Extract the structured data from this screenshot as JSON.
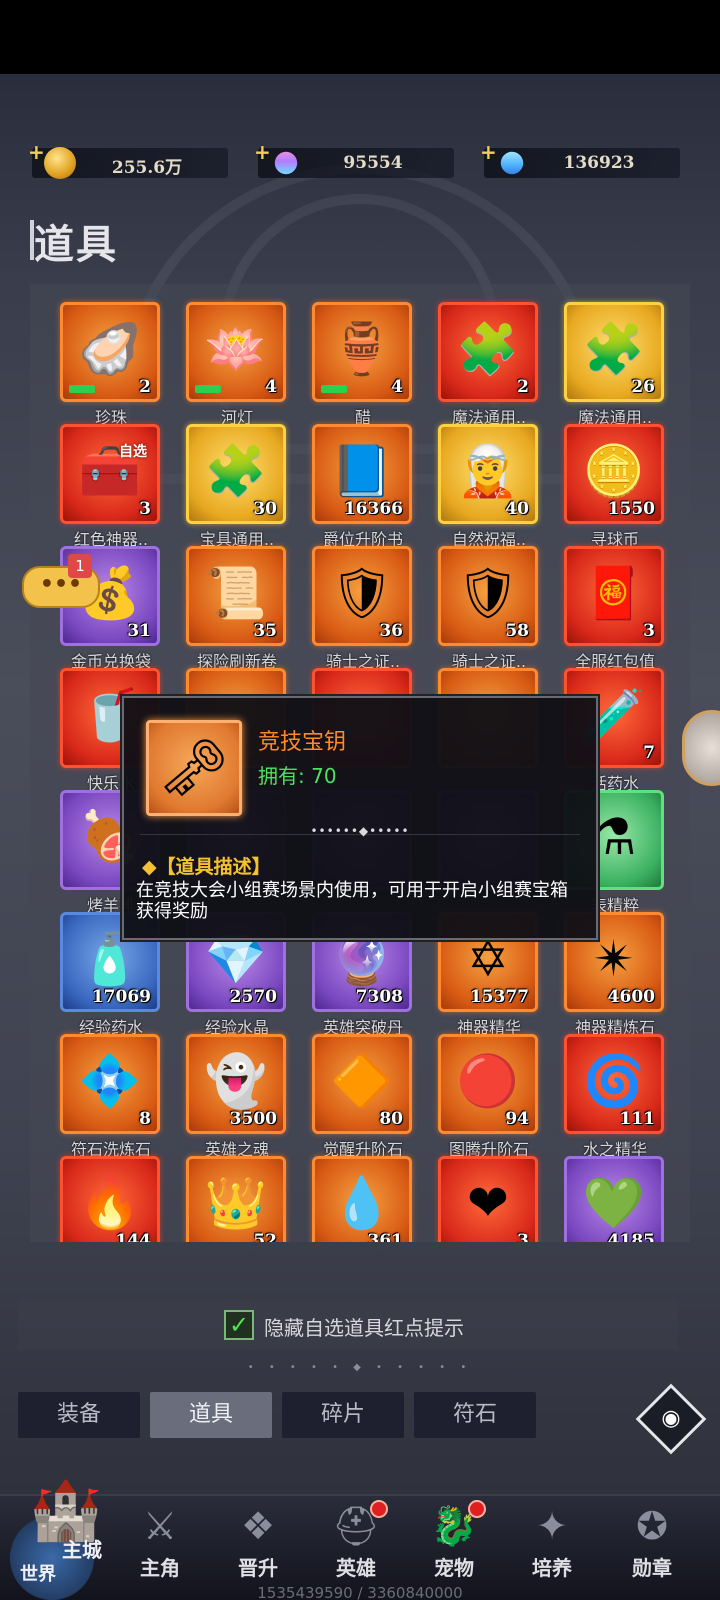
{
  "currency": [
    {
      "icon": "gold-coin-icon",
      "value": "255.6万"
    },
    {
      "icon": "rainbow-crystal-icon",
      "value": "95554"
    },
    {
      "icon": "diamond-icon",
      "value": "136923"
    }
  ],
  "panel_title": "道具",
  "items": [
    {
      "name": "珍珠",
      "count": "2",
      "rarity": "orange",
      "glyph": "🦪",
      "new": true
    },
    {
      "name": "河灯",
      "count": "4",
      "rarity": "orange",
      "glyph": "🪷",
      "new": true
    },
    {
      "name": "醋",
      "count": "4",
      "rarity": "orange",
      "glyph": "🏺",
      "new": true
    },
    {
      "name": "魔法通用..",
      "count": "2",
      "rarity": "red",
      "glyph": "🧩"
    },
    {
      "name": "魔法通用..",
      "count": "26",
      "rarity": "gold",
      "glyph": "🧩"
    },
    {
      "name": "红色神器..",
      "count": "3",
      "rarity": "red",
      "glyph": "🧰",
      "tag": "自选"
    },
    {
      "name": "宝具通用..",
      "count": "30",
      "rarity": "gold",
      "glyph": "🧩"
    },
    {
      "name": "爵位升阶书",
      "count": "16366",
      "rarity": "orange",
      "glyph": "📘"
    },
    {
      "name": "自然祝福..",
      "count": "40",
      "rarity": "gold",
      "glyph": "🧝"
    },
    {
      "name": "寻球币",
      "count": "1550",
      "rarity": "red",
      "glyph": "🪙"
    },
    {
      "name": "金币兑换袋",
      "count": "31",
      "rarity": "purple",
      "glyph": "💰"
    },
    {
      "name": "探险刷新卷",
      "count": "35",
      "rarity": "orange",
      "glyph": "📜"
    },
    {
      "name": "骑士之证..",
      "count": "36",
      "rarity": "orange",
      "glyph": "🛡"
    },
    {
      "name": "骑士之证..",
      "count": "58",
      "rarity": "orange",
      "glyph": "🛡"
    },
    {
      "name": "全服红包值",
      "count": "3",
      "rarity": "red",
      "glyph": "🧧"
    },
    {
      "name": "快乐水",
      "count": "",
      "rarity": "red",
      "glyph": "🥤"
    },
    {
      "name": "",
      "count": "",
      "rarity": "orange",
      "glyph": ""
    },
    {
      "name": "",
      "count": "",
      "rarity": "red",
      "glyph": ""
    },
    {
      "name": "",
      "count": "",
      "rarity": "orange",
      "glyph": ""
    },
    {
      "name": "活药水",
      "count": "7",
      "rarity": "red",
      "glyph": "🧪"
    },
    {
      "name": "烤羊排",
      "count": "",
      "rarity": "purple",
      "glyph": "🍖"
    },
    {
      "name": "",
      "count": "",
      "rarity": "purple",
      "glyph": ""
    },
    {
      "name": "",
      "count": "",
      "rarity": "purple",
      "glyph": ""
    },
    {
      "name": "",
      "count": "",
      "rarity": "purple",
      "glyph": ""
    },
    {
      "name": "表精粹",
      "count": "",
      "rarity": "green",
      "glyph": "⚗"
    },
    {
      "name": "经验药水",
      "count": "17069",
      "rarity": "blue",
      "glyph": "🧴"
    },
    {
      "name": "经验水晶",
      "count": "2570",
      "rarity": "purple",
      "glyph": "💎"
    },
    {
      "name": "英雄突破丹",
      "count": "7308",
      "rarity": "purple",
      "glyph": "🔮"
    },
    {
      "name": "神器精华",
      "count": "15377",
      "rarity": "orange",
      "glyph": "✡"
    },
    {
      "name": "神器精炼石",
      "count": "4600",
      "rarity": "orange",
      "glyph": "✴"
    },
    {
      "name": "符石洗炼石",
      "count": "8",
      "rarity": "orange",
      "glyph": "💠"
    },
    {
      "name": "英雄之魂",
      "count": "3500",
      "rarity": "orange",
      "glyph": "👻"
    },
    {
      "name": "觉醒升阶石",
      "count": "80",
      "rarity": "orange",
      "glyph": "🔶"
    },
    {
      "name": "图腾升阶石",
      "count": "94",
      "rarity": "orange",
      "glyph": "🔴"
    },
    {
      "name": "水之精华",
      "count": "111",
      "rarity": "red",
      "glyph": "🌀"
    },
    {
      "name": "",
      "count": "144",
      "rarity": "red",
      "glyph": "🔥"
    },
    {
      "name": "",
      "count": "52",
      "rarity": "orange",
      "glyph": "👑"
    },
    {
      "name": "",
      "count": "361",
      "rarity": "orange",
      "glyph": "💧"
    },
    {
      "name": "",
      "count": "3",
      "rarity": "red",
      "glyph": "❤"
    },
    {
      "name": "",
      "count": "4185",
      "rarity": "purple",
      "glyph": "💚"
    }
  ],
  "chat_badge": "1",
  "chat_bubble": "•••",
  "tooltip": {
    "icon": "golden-key-icon",
    "name": "竞技宝钥",
    "owned": "拥有: 70",
    "dots": "••••••◆•••••",
    "desc_heading": "◆【道具描述】",
    "desc": "在竞技大会小组赛场景内使用，可用于开启小组赛宝箱获得奖励"
  },
  "hide_label": "隐藏自选道具红点提示",
  "hide_checked": "✓",
  "page_dots": "• • • • • ◆ • • • • •",
  "tabs": [
    "装备",
    "道具",
    "碎片",
    "符石"
  ],
  "active_tab": 1,
  "nav": {
    "city_top": "主城",
    "city_bottom": "世界",
    "items": [
      {
        "label": "主角",
        "icon": "hero-helmet-icon",
        "glyph": "⚔",
        "dot": false
      },
      {
        "label": "晋升",
        "icon": "wings-crest-icon",
        "glyph": "❖",
        "dot": false
      },
      {
        "label": "英雄",
        "icon": "knight-helmet-icon",
        "glyph": "⛑",
        "dot": true
      },
      {
        "label": "宠物",
        "icon": "dragon-head-icon",
        "glyph": "🐉",
        "dot": true
      },
      {
        "label": "培养",
        "icon": "compass-star-icon",
        "glyph": "✦",
        "dot": false
      },
      {
        "label": "勋章",
        "icon": "medal-icon",
        "glyph": "✪",
        "dot": false
      }
    ]
  },
  "footer_counter": "1535439590 / 3360840000"
}
